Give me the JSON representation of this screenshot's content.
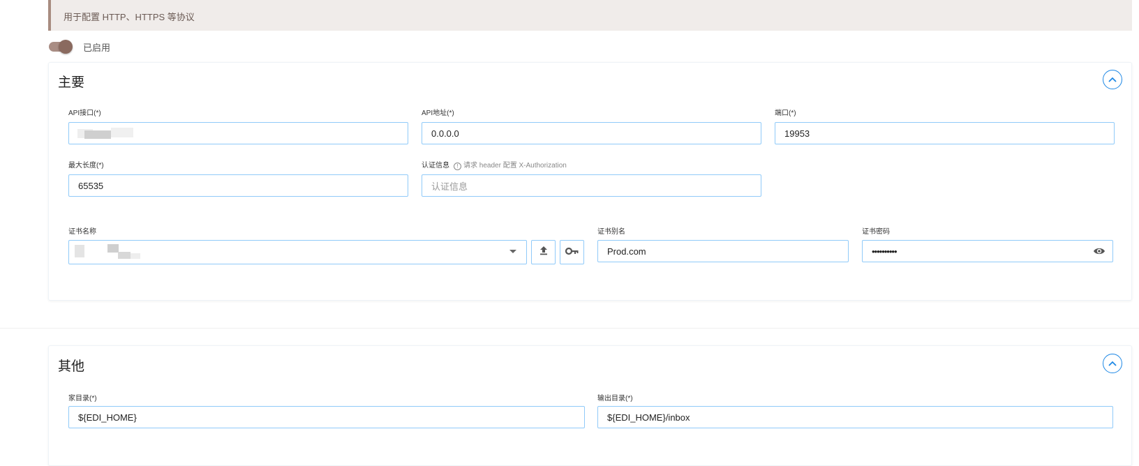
{
  "banner": {
    "text": "用于配置 HTTP、HTTPS 等协议"
  },
  "toggle": {
    "label": "已启用",
    "enabled": true
  },
  "main_section": {
    "title": "主要",
    "api_interface": {
      "label": "API接口(*)",
      "value": ""
    },
    "api_address": {
      "label": "API地址(*)",
      "value": "0.0.0.0"
    },
    "port": {
      "label": "端口(*)",
      "value": "19953"
    },
    "max_length": {
      "label": "最大长度(*)",
      "value": "65535"
    },
    "auth_info": {
      "label": "认证信息",
      "hint": "请求 header 配置 X-Authorization",
      "placeholder": "认证信息",
      "value": ""
    },
    "cert_name": {
      "label": "证书名称",
      "value": ""
    },
    "cert_alias": {
      "label": "证书别名",
      "value": "Prod.com"
    },
    "cert_password": {
      "label": "证书密码",
      "masked_value": "••••••••••"
    }
  },
  "other_section": {
    "title": "其他",
    "home_dir": {
      "label": "家目录(*)",
      "value": "${EDI_HOME}"
    },
    "output_dir": {
      "label": "输出目录(*)",
      "value": "${EDI_HOME}/inbox"
    }
  },
  "colors": {
    "accent": "#1e88e5",
    "input_border": "#90caf9",
    "toggle": "#8a6a5f",
    "banner_bg": "#f0ecea"
  },
  "icons": [
    "chevron-up-icon",
    "chevron-down-icon",
    "upload-icon",
    "key-icon",
    "eye-icon",
    "info-icon"
  ]
}
